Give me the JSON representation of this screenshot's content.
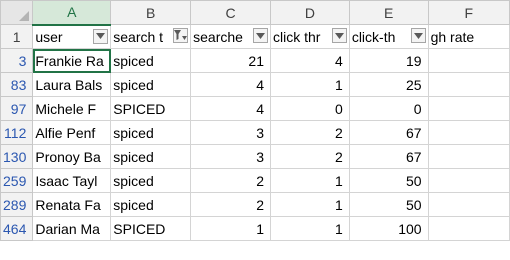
{
  "columns": [
    "A",
    "B",
    "C",
    "D",
    "E",
    "F"
  ],
  "header_row": {
    "row_number": "1",
    "cells": [
      "user",
      "search t",
      "searche",
      "click thr",
      "click-th",
      "gh rate"
    ]
  },
  "rows": [
    {
      "row_number": "3",
      "user": "Frankie Ra",
      "search_term": "spiced",
      "searches": "21",
      "clicks": "4",
      "rate": "19"
    },
    {
      "row_number": "83",
      "user": "Laura Bals",
      "search_term": "spiced",
      "searches": "4",
      "clicks": "1",
      "rate": "25"
    },
    {
      "row_number": "97",
      "user": "Michele F",
      "search_term": "SPICED",
      "searches": "4",
      "clicks": "0",
      "rate": "0"
    },
    {
      "row_number": "112",
      "user": "Alfie Penf",
      "search_term": "spiced",
      "searches": "3",
      "clicks": "2",
      "rate": "67"
    },
    {
      "row_number": "130",
      "user": "Pronoy Ba",
      "search_term": "spiced",
      "searches": "3",
      "clicks": "2",
      "rate": "67"
    },
    {
      "row_number": "259",
      "user": "Isaac Tayl",
      "search_term": "spiced",
      "searches": "2",
      "clicks": "1",
      "rate": "50"
    },
    {
      "row_number": "289",
      "user": "Renata Fa",
      "search_term": "spiced",
      "searches": "2",
      "clicks": "1",
      "rate": "50"
    },
    {
      "row_number": "464",
      "user": "Darian Ma",
      "search_term": "SPICED",
      "searches": "1",
      "clicks": "1",
      "rate": "100"
    }
  ],
  "icons": {
    "filter_dropdown": "chevron-down-icon",
    "filter_active": "filter-active-icon",
    "select_all": "select-all-corner"
  },
  "colors": {
    "selected_accent": "#217346",
    "row_number_filtered": "#2b57b0",
    "gridline": "#d4d4d4",
    "header_bg": "#f2f2f2"
  }
}
